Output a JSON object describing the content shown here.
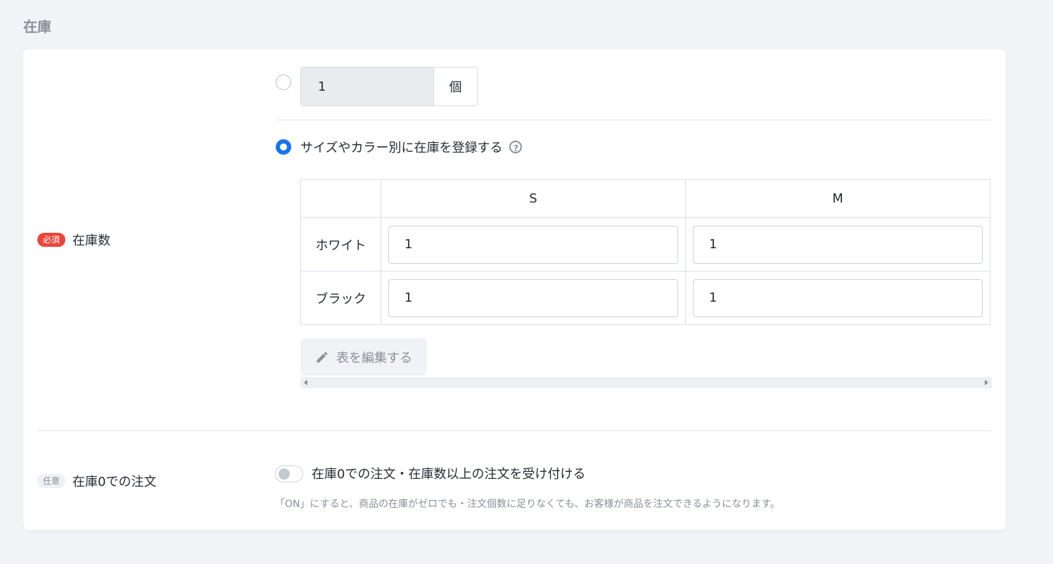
{
  "section": {
    "title": "在庫"
  },
  "stock_field": {
    "required_badge": "必須",
    "label": "在庫数",
    "simple_option": {
      "quantity": "1",
      "unit": "個"
    },
    "variant_option": {
      "label": "サイズやカラー別に在庫を登録する",
      "help_icon": "?",
      "columns": [
        "S",
        "M"
      ],
      "rows": [
        {
          "name": "ホワイト",
          "values": [
            "1",
            "1"
          ]
        },
        {
          "name": "ブラック",
          "values": [
            "1",
            "1"
          ]
        }
      ],
      "edit_button": "表を編集する"
    }
  },
  "zero_stock_field": {
    "optional_badge": "任意",
    "label": "在庫0での注文",
    "toggle_label": "在庫0での注文・在庫数以上の注文を受け付ける",
    "toggle_on": false,
    "help_text": "「ON」にすると、商品の在庫がゼロでも・注文個数に足りなくても、お客様が商品を注文できるようになります。"
  },
  "colors": {
    "accent": "#1a73e8",
    "required": "#e8473d"
  }
}
